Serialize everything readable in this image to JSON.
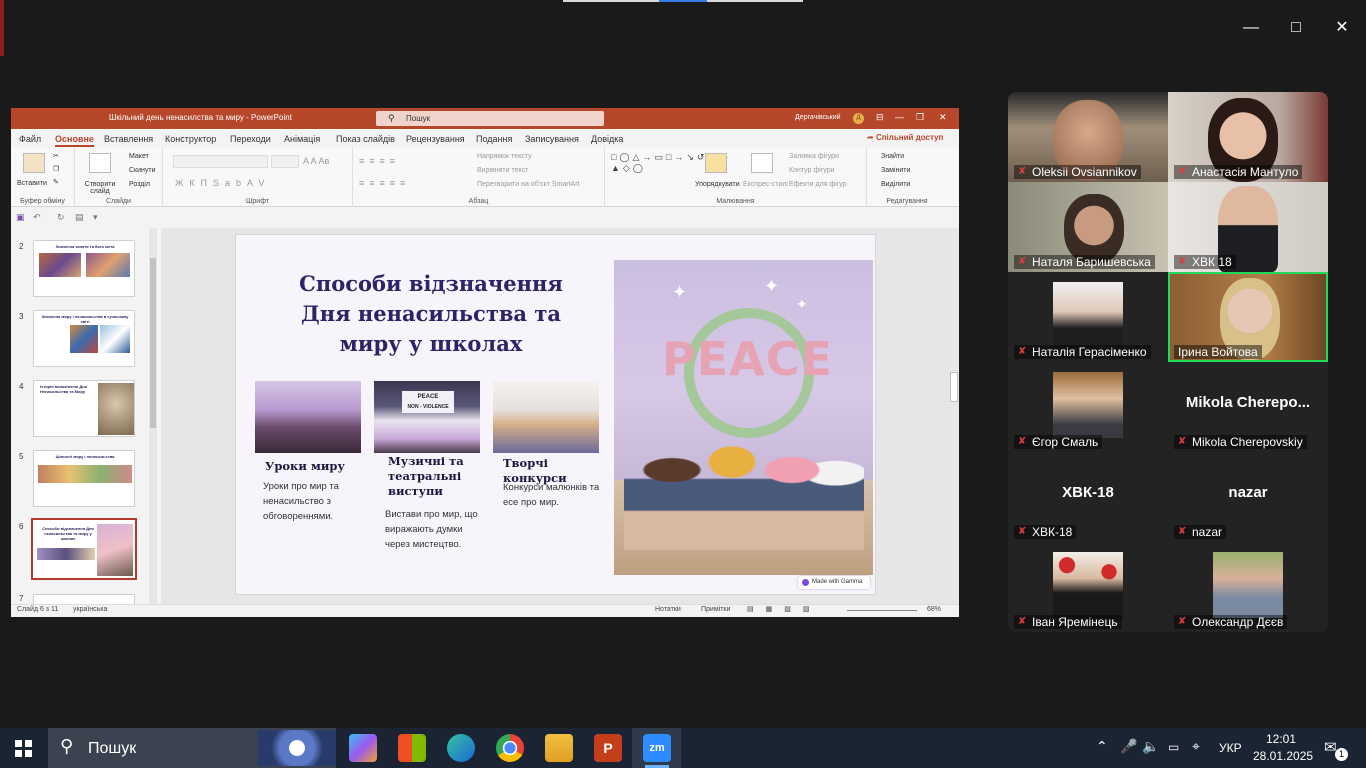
{
  "window": {
    "minimize_icon": "minimize-icon",
    "maximize_icon": "maximize-icon",
    "close_icon": "close-icon"
  },
  "ppt": {
    "title": "Шкільний день ненасилства та миру  -  PowerPoint",
    "search_placeholder": "Пошук",
    "user": "Дергачівський",
    "user_initial": "Д",
    "menu": [
      "Файл",
      "Основне",
      "Вставлення",
      "Конструктор",
      "Переходи",
      "Анімація",
      "Показ слайдів",
      "Рецензування",
      "Подання",
      "Записування",
      "Довідка"
    ],
    "share": "Спільний доступ",
    "ribbon": {
      "paste": "Вставити",
      "clipboard": "Буфер обміну",
      "new_slide": "Створити слайд",
      "layout": "Макет",
      "reset": "Скинути",
      "section": "Розділ",
      "slides": "Слайди",
      "font": "Шрифт",
      "text_direction": "Напрямок тексту",
      "align_text": "Вирівняти текст",
      "smartart": "Перетворити на об'єкт SmartArt",
      "paragraph": "Абзац",
      "arrange": "Упорядкувати",
      "quick_styles": "Експрес-стилі",
      "fill": "Заливка фігури",
      "outline": "Контур фігури",
      "effects": "Ефекти для фігур",
      "drawing": "Малювання",
      "find": "Знайти",
      "replace": "Замінити",
      "select": "Виділити",
      "editing": "Редагування"
    },
    "thumbnails": [
      {
        "num": "2",
        "title": "Значення занятя та його мета"
      },
      {
        "num": "3",
        "title": "Значення миру і ненасильства в сучасному світі"
      },
      {
        "num": "4",
        "title": "Історія виникнення Дня Ненасильства та Миру"
      },
      {
        "num": "5",
        "title": "Цінності миру і ненасильства"
      },
      {
        "num": "6",
        "title": "Способи відзначення Дня ненасильства та миру у школах"
      },
      {
        "num": "7",
        "title": ""
      }
    ],
    "slide": {
      "title": "Способи відзначення Дня ненасильства та миру у школах",
      "cards": [
        {
          "heading": "Уроки миру",
          "text": "Уроки про мир та ненасильство з обговореннями."
        },
        {
          "heading": "Музичні та театральні виступи",
          "text": "Вистави про мир, що виражають думки через мистецтво."
        },
        {
          "heading": "Творчі конкурси",
          "text": "Конкурси малюнків та есе про мир."
        }
      ],
      "image_banner": "PEACE",
      "stage_banner": "PEACE",
      "stage_sub": "NON - VIOLENCE",
      "gamma_badge": "Made with Gamma"
    },
    "status": {
      "slide": "Слайд 6 з 11",
      "language": "українська",
      "notes": "Нотатки",
      "comments": "Примітки",
      "zoom": "68%"
    }
  },
  "participants": [
    {
      "name": "Oleksii Ovsiannikov",
      "video": true
    },
    {
      "name": "Анастасія Мантуло",
      "video": true
    },
    {
      "name": "Наталя Баришевська",
      "video": true
    },
    {
      "name": "ХВК 18",
      "video": true
    },
    {
      "name": "Наталія Герасіменко",
      "video": true
    },
    {
      "name": "Ірина Войтова",
      "video": true,
      "active": true
    },
    {
      "name": "Єгор Смаль",
      "video": true
    },
    {
      "name": "Mikola Cherepovskiy",
      "display": "Mikola  Cherepo...",
      "video": false
    },
    {
      "name": "ХВК-18",
      "display": "ХВК-18",
      "video": false
    },
    {
      "name": "nazar",
      "display": "nazar",
      "video": false
    },
    {
      "name": "Іван Яремінець",
      "video": true
    },
    {
      "name": "Олександр Дєєв",
      "video": true
    }
  ],
  "taskbar": {
    "search": "Пошук",
    "lang": "УКР",
    "time": "12:01",
    "date": "28.01.2025",
    "notifications": "1",
    "apps": [
      "copilot-icon",
      "store-icon",
      "edge-icon",
      "chrome-icon",
      "file-explorer-icon",
      "powerpoint-icon",
      "zoom-icon"
    ]
  },
  "colors": {
    "ppt_accent": "#b7472a",
    "slide_title": "#2b2466",
    "active_speaker": "#23d959",
    "taskbar": "#1b2433"
  }
}
